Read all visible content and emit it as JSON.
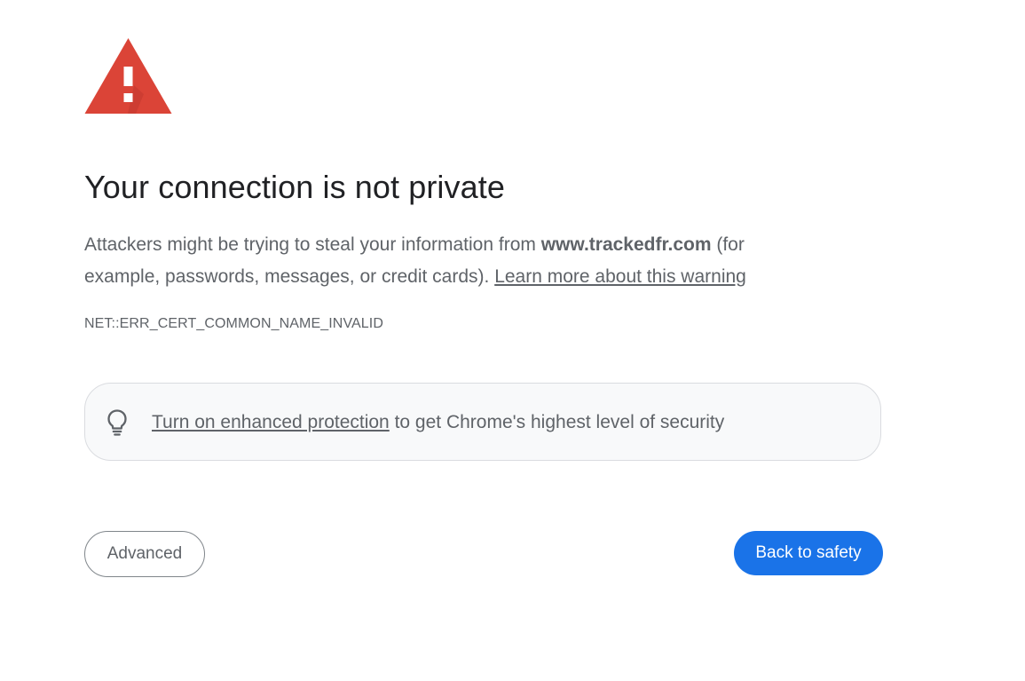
{
  "heading": "Your connection is not private",
  "explanation": {
    "prefix": "Attackers might be trying to steal your information from ",
    "domain": "www.trackedfr.com",
    "suffix": " (for example, passwords, messages, or credit cards). ",
    "learn_more_link": "Learn more about this warning"
  },
  "error_code": "NET::ERR_CERT_COMMON_NAME_INVALID",
  "enhanced_protection": {
    "link_text": "Turn on enhanced protection",
    "rest_text": " to get Chrome's highest level of security",
    "icon": "lightbulb-icon"
  },
  "buttons": {
    "advanced": "Advanced",
    "back_to_safety": "Back to safety"
  },
  "icons": {
    "warning": "warning-triangle-icon"
  },
  "colors": {
    "warning_red": "#db4437",
    "primary_blue": "#1a73e8",
    "text_dark": "#202124",
    "text_secondary": "#5f6368"
  }
}
